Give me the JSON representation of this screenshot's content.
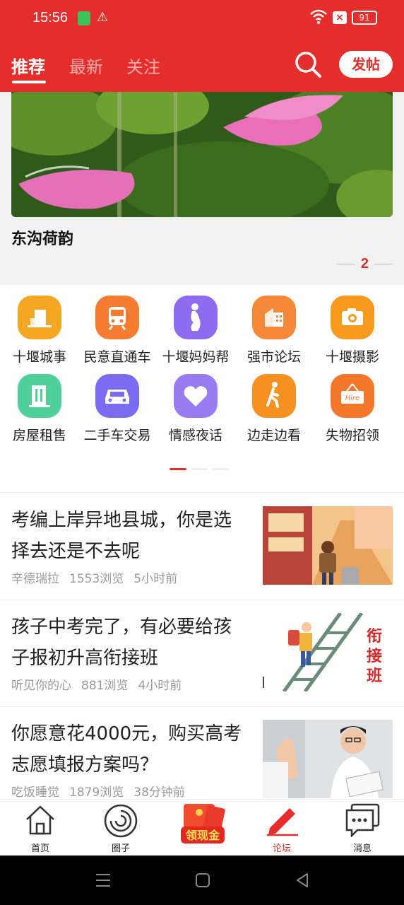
{
  "status_bar": {
    "time": "15:56",
    "battery": "91"
  },
  "header": {
    "tabs": [
      "推荐",
      "最新",
      "关注"
    ],
    "post_button": "发帖",
    "accent_color": "#e52d2b"
  },
  "banner": {
    "title": "东沟荷韵",
    "page": "2"
  },
  "categories": [
    {
      "label": "十堰城事",
      "icon": "building-icon",
      "color": "#f5a623"
    },
    {
      "label": "民意直通车",
      "icon": "train-icon",
      "color": "#f57c30"
    },
    {
      "label": "十堰妈妈帮",
      "icon": "mother-icon",
      "color": "#8e6cf0"
    },
    {
      "label": "强市论坛",
      "icon": "office-icon",
      "color": "#f6883a"
    },
    {
      "label": "十堰摄影",
      "icon": "camera-icon",
      "color": "#f79a1e"
    },
    {
      "label": "房屋租售",
      "icon": "house-icon",
      "color": "#4fcf9a"
    },
    {
      "label": "二手车交易",
      "icon": "car-icon",
      "color": "#7a6cf2"
    },
    {
      "label": "情感夜话",
      "icon": "heart-icon",
      "color": "#9a7cf2"
    },
    {
      "label": "边走边看",
      "icon": "walker-icon",
      "color": "#f79222"
    },
    {
      "label": "失物招领",
      "icon": "hire-sign-icon",
      "color": "#f5772a"
    }
  ],
  "feed": [
    {
      "title": "考编上岸异地县城，你是选择去还是不去呢",
      "author": "辛德瑞拉",
      "views": "1553浏览",
      "time": "5小时前"
    },
    {
      "title": "孩子中考完了，有必要给孩子报初升高衔接班",
      "author": "听见你的心",
      "views": "881浏览",
      "time": "4小时前"
    },
    {
      "title": "你愿意花4000元，购买高考志愿填报方案吗？",
      "author": "吃饭睡觉",
      "views": "1879浏览",
      "time": "38分钟前"
    }
  ],
  "bottom_nav": [
    {
      "label": "首页",
      "icon": "home-icon"
    },
    {
      "label": "圈子",
      "icon": "circle-icon"
    },
    {
      "label": "领现金",
      "icon": "red-envelope-icon"
    },
    {
      "label": "论坛",
      "icon": "pen-icon"
    },
    {
      "label": "消息",
      "icon": "message-icon"
    }
  ]
}
